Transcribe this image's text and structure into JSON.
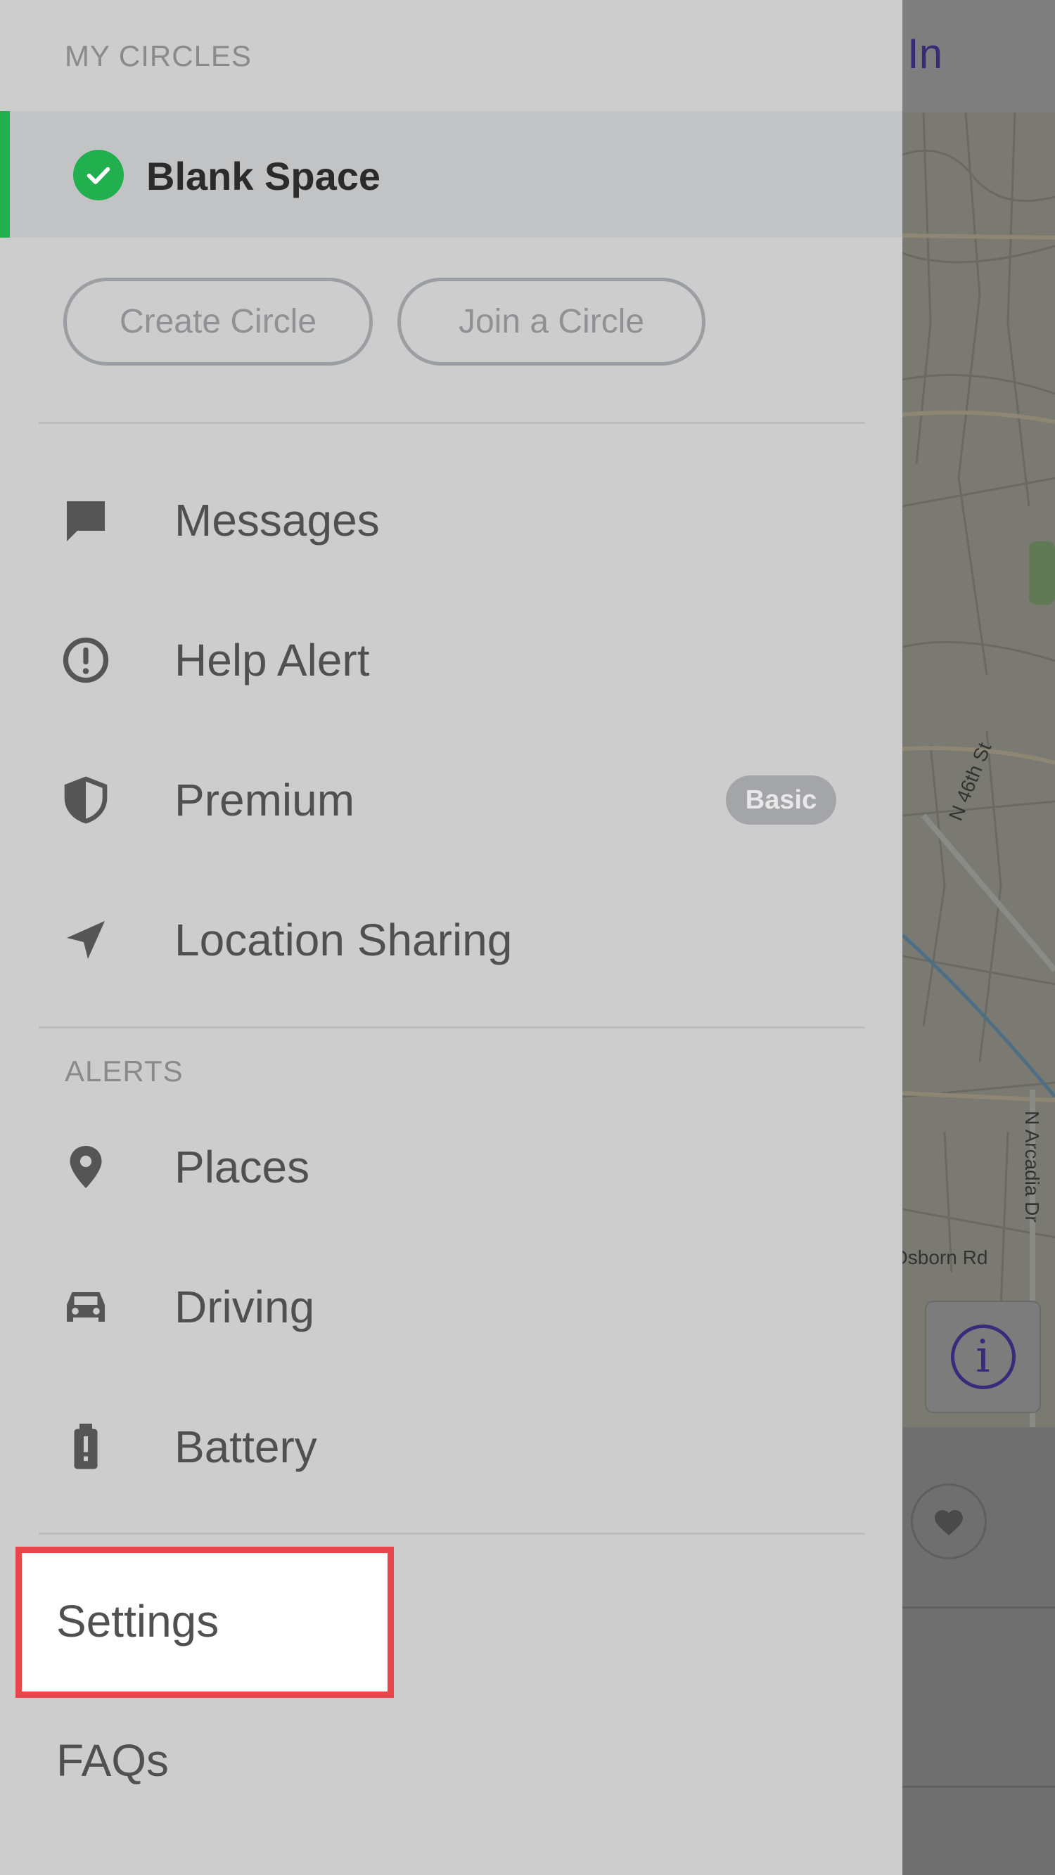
{
  "header": {
    "checkin_label": "eck In"
  },
  "map": {
    "streets": [
      "N 46th St",
      "N Arcadia Dr",
      "Osborn Rd"
    ],
    "info_label": "i"
  },
  "drawer": {
    "my_circles_title": "MY CIRCLES",
    "active_circle": {
      "name": "Blank Space"
    },
    "create_circle_label": "Create Circle",
    "join_circle_label": "Join a Circle",
    "main_items": [
      {
        "label": "Messages",
        "icon": "message-icon"
      },
      {
        "label": "Help Alert",
        "icon": "alert-icon"
      },
      {
        "label": "Premium",
        "icon": "shield-icon",
        "badge": "Basic"
      },
      {
        "label": "Location Sharing",
        "icon": "location-arrow-icon"
      }
    ],
    "alerts_title": "ALERTS",
    "alert_items": [
      {
        "label": "Places",
        "icon": "map-pin-icon"
      },
      {
        "label": "Driving",
        "icon": "car-icon"
      },
      {
        "label": "Battery",
        "icon": "battery-icon"
      }
    ],
    "settings_label": "Settings",
    "faqs_label": "FAQs"
  },
  "colors": {
    "accent_green": "#22b04f",
    "highlight_red": "#e8464d",
    "brand_purple": "#3a2a7a"
  }
}
